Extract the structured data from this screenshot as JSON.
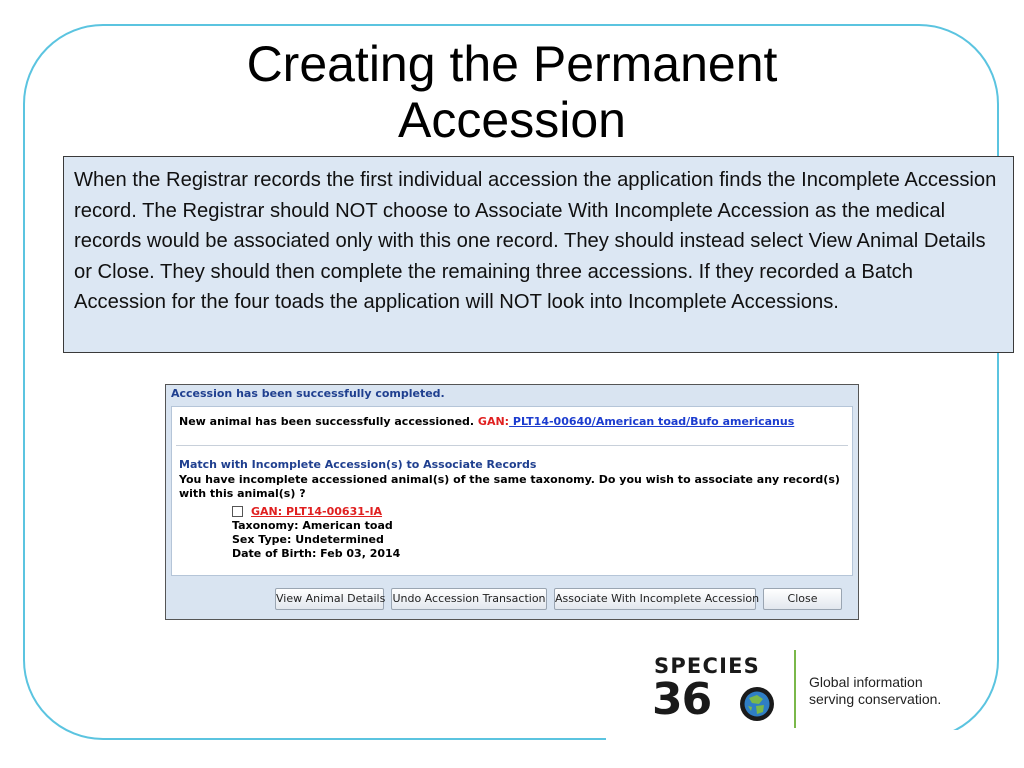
{
  "slide": {
    "title_line1": "Creating the Permanent",
    "title_line2": "Accession",
    "callout_text": "When the Registrar records the first individual accession the application finds the Incomplete Accession record. The Registrar should NOT choose to Associate With Incomplete Accession as the medical records would be associated only with this one record. They should instead select View Animal Details or Close. They should then complete the remaining three accessions. If they recorded a Batch Accession for the four toads the application will NOT look into Incomplete Accessions."
  },
  "dialog": {
    "header": "Accession has been successfully completed.",
    "success_text": "New animal has been successfully accessioned.",
    "gan_label": "GAN:",
    "gan_link": " PLT14-00640/American toad/Bufo americanus",
    "match_heading": "Match with Incomplete Accession(s) to Associate Records",
    "question": "You have incomplete accessioned animal(s) of the same taxonomy. Do you wish to associate any record(s) with this animal(s) ?",
    "record": {
      "gan": "GAN: PLT14-00631-IA",
      "taxonomy": "Taxonomy: American toad",
      "sex": "Sex Type: Undetermined",
      "dob": "Date of Birth: Feb 03, 2014"
    },
    "buttons": {
      "view": "View Animal Details",
      "undo": "Undo Accession Transaction",
      "associate": "Associate With Incomplete Accession",
      "close": "Close"
    }
  },
  "logo": {
    "word": "SPECIES",
    "number": "36",
    "tagline_line1": "Global information",
    "tagline_line2": "serving conservation.",
    "colors": {
      "green": "#7ab84a",
      "blue": "#2f7ec4",
      "dark": "#1a1a1a"
    }
  },
  "colors": {
    "frame": "#5bc4e0",
    "callout_bg": "#dce7f3",
    "dialog_bg": "#d9e4f1",
    "link": "#1c3ccf",
    "alert": "#e02020"
  }
}
